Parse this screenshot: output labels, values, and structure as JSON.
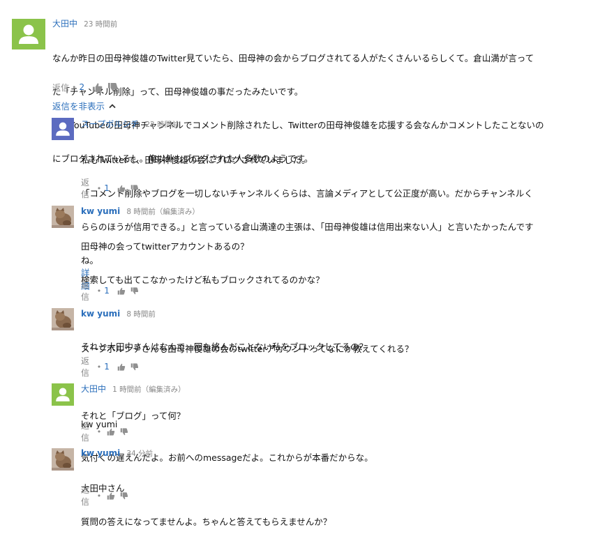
{
  "comments": [
    {
      "author": "大田中",
      "time": "23 時間前",
      "lines": [
        "なんか昨日の田母神俊雄のTwitter見ていたら、田母神の会からブログされてる人がたくさんいるらしくて。倉山満が言って",
        "た「チャンネル削除」って、田母神俊雄の事だったみたいです。",
        "俺もYouTubeの田母神チャンネルでコメント削除されたし、Twitterの田母神俊雄を応援する会なんかコメントしたことないの",
        "にブログされているし。俺以外もブログされた人多数のようです。"
      ],
      "reply_label": "返信",
      "like_count": "2"
    }
  ],
  "replies_toggle": "返信を非表示",
  "replies": [
    {
      "author": "スープボルシチ",
      "time": "22 時間前",
      "lines": [
        "私もTwitterで、田母神俊雄の会にブログされていました。",
        "「コメント削除やブログを一切しないチャンネルくららは、言論メディアとして公正度が高い。だからチャンネルく",
        "ららのほうが信用できる。」と言っている倉山満達の主張は、「田母神俊雄は信用出来ない人」と言いたかったんです",
        "ね。"
      ],
      "reply_label": "返信",
      "like_count": "1"
    },
    {
      "author": "kw yumi",
      "time": "8 時間前（編集済み）",
      "lines": [
        "田母神の会ってtwitterアカウントあるの？",
        "検索しても出てこなかったけど私もブロックされてるのかな？",
        "",
        "それと大田中さんはなんで一回も絡んだことない私をブロックしてるの？"
      ],
      "more_label": "詳細",
      "reply_label": "返信",
      "like_count": "1"
    },
    {
      "author": "kw yumi",
      "time": "8 時間前",
      "lines": [
        "スープボルシチさんも田母神俊雄の会のtwitterアカウントってなにか教えてくれる？",
        "",
        "それと「ブログ」って何？"
      ],
      "reply_label": "返信",
      "like_count": "1"
    },
    {
      "author": "大田中",
      "time": "1 時間前（編集済み）",
      "lines": [
        "kw yumi",
        "気付くの遅えんだよ。お前へのmessageだよ。これからが本番だからな。"
      ],
      "reply_label": "返信",
      "like_count": ""
    },
    {
      "author": "kw yumi",
      "time": "34 分前",
      "lines": [
        "大田中さん",
        "質問の答えになってませんよ。ちゃんと答えてもらえませんか？"
      ],
      "reply_label": "返信",
      "like_count": ""
    }
  ],
  "icons": {
    "like": "thumbs-up-icon",
    "dislike": "thumbs-down-icon",
    "chevron": "chevron-up-icon",
    "default_avatar": "user-silhouette-icon"
  },
  "colors": {
    "link": "#2a6ebb",
    "meta": "#888888",
    "icon": "#909090",
    "avatar_green": "#8bc34a",
    "avatar_blue": "#5c6bc0"
  }
}
